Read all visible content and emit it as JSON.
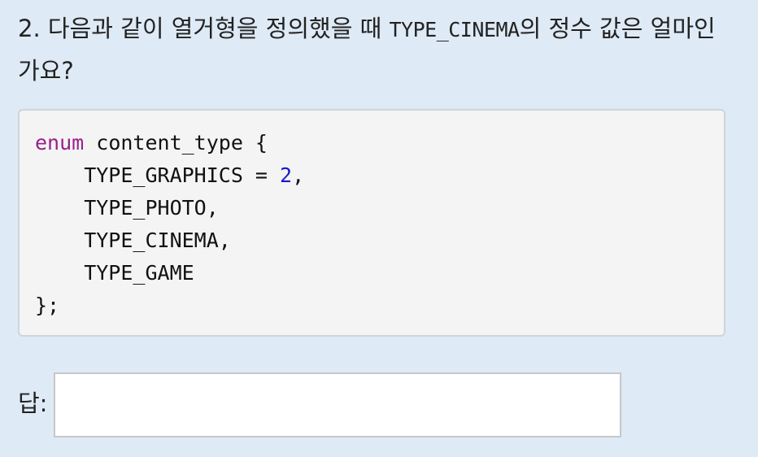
{
  "question": {
    "prefix": "2. 다음과 같이 열거형을 정의했을 때 ",
    "inline_code": "TYPE_CINEMA",
    "suffix": "의 정수 값은 얼마인가요?"
  },
  "code": {
    "keyword": "enum",
    "line1_rest": " content_type {",
    "line2_name": "    TYPE_GRAPHICS = ",
    "line2_value": "2",
    "line2_tail": ",",
    "line3": "    TYPE_PHOTO,",
    "line4": "    TYPE_CINEMA,",
    "line5": "    TYPE_GAME",
    "line6": "};"
  },
  "answer": {
    "label": "답:",
    "value": "",
    "placeholder": ""
  },
  "colors": {
    "background": "#deeaf6",
    "code_background": "#f4f4f4",
    "keyword": "#9a1f8a",
    "number": "#1a1acc"
  }
}
